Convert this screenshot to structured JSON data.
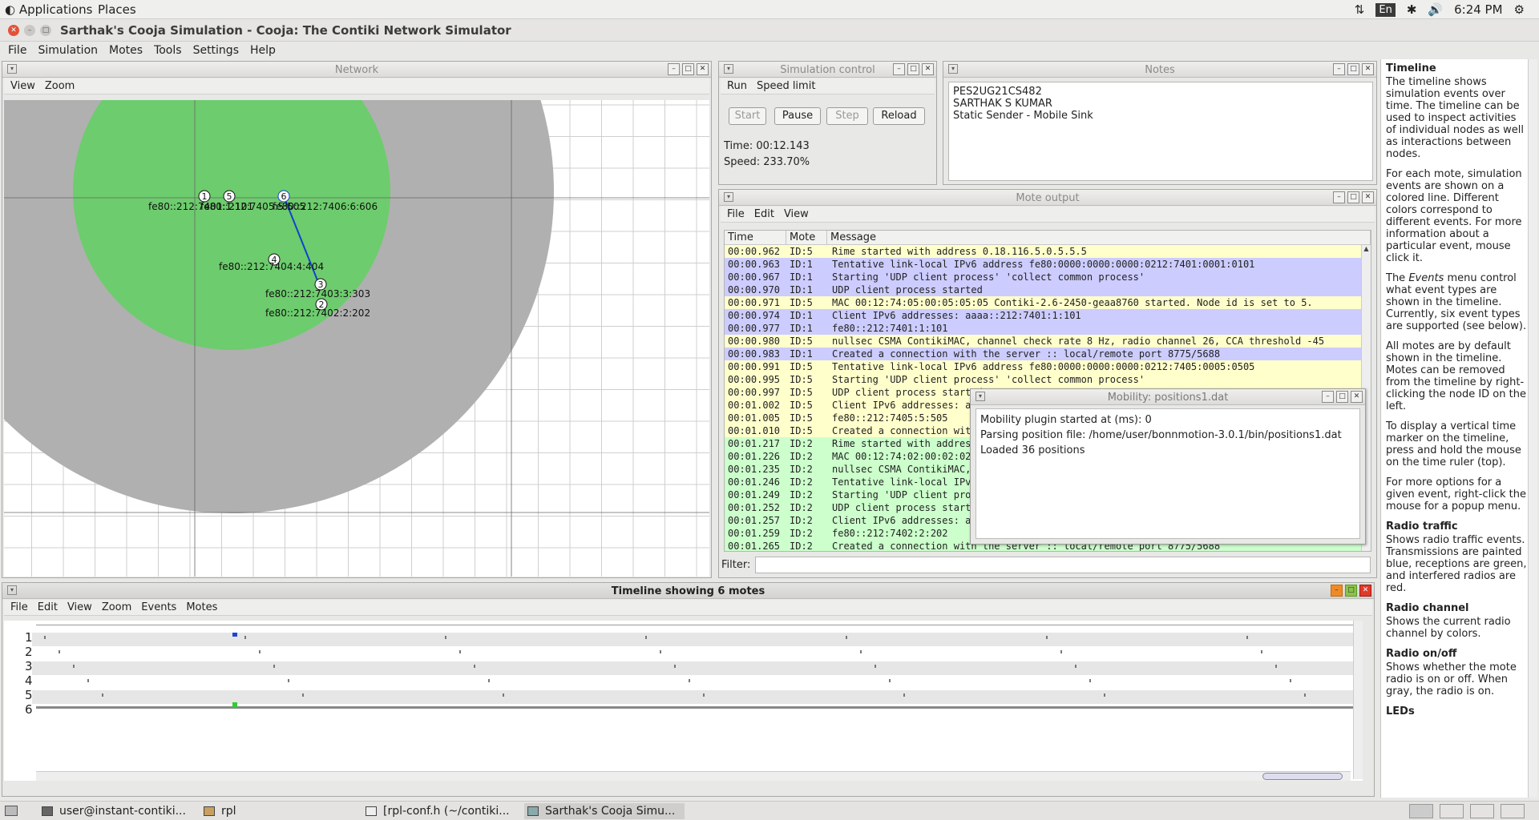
{
  "topbar": {
    "applications": "Applications",
    "places": "Places",
    "lang": "En",
    "time": "6:24 PM"
  },
  "window": {
    "title": "Sarthak's Cooja Simulation - Cooja: The Contiki Network Simulator"
  },
  "menu": [
    "File",
    "Simulation",
    "Motes",
    "Tools",
    "Settings",
    "Help"
  ],
  "network": {
    "title": "Network",
    "menu": [
      "View",
      "Zoom"
    ],
    "nodes": [
      {
        "id": "1",
        "label": "fe80::212:7401:1:101"
      },
      {
        "id": "5",
        "label": "fe80::212:7405:5:505"
      },
      {
        "id": "6",
        "label": "fe80::212:7406:6:606"
      },
      {
        "id": "4",
        "label": "fe80::212:7404:4:404"
      },
      {
        "id": "3",
        "label": "fe80::212:7403:3:303"
      },
      {
        "id": "2",
        "label": "fe80::212:7402:2:202"
      }
    ]
  },
  "simcontrol": {
    "title": "Simulation control",
    "menu": [
      "Run",
      "Speed limit"
    ],
    "start": "Start",
    "pause": "Pause",
    "step": "Step",
    "reload": "Reload",
    "time": "Time: 00:12.143",
    "speed": "Speed: 233.70%"
  },
  "notes": {
    "title": "Notes",
    "lines": [
      "PES2UG21CS482",
      "SARTHAK S KUMAR",
      "Static Sender - Mobile Sink"
    ]
  },
  "moteoutput": {
    "title": "Mote output",
    "menu": [
      "File",
      "Edit",
      "View"
    ],
    "headers": [
      "Time",
      "Mote",
      "Message"
    ],
    "filter_label": "Filter:",
    "rows": [
      [
        "00:00.962",
        "ID:5",
        "Rime started with address 0.18.116.5.0.5.5.5"
      ],
      [
        "00:00.963",
        "ID:1",
        "Tentative link-local IPv6 address fe80:0000:0000:0000:0212:7401:0001:0101"
      ],
      [
        "00:00.967",
        "ID:1",
        "Starting 'UDP client process' 'collect common process'"
      ],
      [
        "00:00.970",
        "ID:1",
        "UDP client process started"
      ],
      [
        "00:00.971",
        "ID:5",
        "MAC 00:12:74:05:00:05:05:05 Contiki-2.6-2450-geaa8760 started. Node id is set to 5."
      ],
      [
        "00:00.974",
        "ID:1",
        "Client IPv6 addresses: aaaa::212:7401:1:101"
      ],
      [
        "00:00.977",
        "ID:1",
        "fe80::212:7401:1:101"
      ],
      [
        "00:00.980",
        "ID:5",
        "nullsec CSMA ContikiMAC, channel check rate 8 Hz, radio channel 26, CCA threshold -45"
      ],
      [
        "00:00.983",
        "ID:1",
        "Created a connection with the server :: local/remote port 8775/5688"
      ],
      [
        "00:00.991",
        "ID:5",
        "Tentative link-local IPv6 address fe80:0000:0000:0000:0212:7405:0005:0505"
      ],
      [
        "00:00.995",
        "ID:5",
        "Starting 'UDP client process' 'collect common process'"
      ],
      [
        "00:00.997",
        "ID:5",
        "UDP client process started"
      ],
      [
        "00:01.002",
        "ID:5",
        "Client IPv6 addresses: aaaa::212:7405:5:505"
      ],
      [
        "00:01.005",
        "ID:5",
        "fe80::212:7405:5:505"
      ],
      [
        "00:01.010",
        "ID:5",
        "Created a connection with the server :: local/remote port 8775/5688"
      ],
      [
        "00:01.217",
        "ID:2",
        "Rime started with address 0.18.116.2.0.2.2.2"
      ],
      [
        "00:01.226",
        "ID:2",
        "MAC 00:12:74:02:00:02:02:02 Contiki-2.6-2450-geaa8760 started. Node id is set to 2."
      ],
      [
        "00:01.235",
        "ID:2",
        "nullsec CSMA ContikiMAC, channel check rate 8 Hz, radio channel 26, CCA threshold -45"
      ],
      [
        "00:01.246",
        "ID:2",
        "Tentative link-local IPv6 address fe80:0000:0000:0000:0212:7402:0002:0202"
      ],
      [
        "00:01.249",
        "ID:2",
        "Starting 'UDP client process' 'collect common process'"
      ],
      [
        "00:01.252",
        "ID:2",
        "UDP client process started"
      ],
      [
        "00:01.257",
        "ID:2",
        "Client IPv6 addresses: aaaa::212:7402:2:202"
      ],
      [
        "00:01.259",
        "ID:2",
        "fe80::212:7402:2:202"
      ],
      [
        "00:01.265",
        "ID:2",
        "Created a connection with the server :: local/remote port 8775/5688"
      ]
    ]
  },
  "mobility": {
    "title": "Mobility: positions1.dat",
    "lines": [
      "Mobility plugin started at (ms): 0",
      "Parsing position file: /home/user/bonnmotion-3.0.1/bin/positions1.dat",
      "Loaded 36 positions"
    ]
  },
  "timeline": {
    "title": "Timeline showing 6 motes",
    "menu": [
      "File",
      "Edit",
      "View",
      "Zoom",
      "Events",
      "Motes"
    ],
    "rows": [
      "1",
      "2",
      "3",
      "4",
      "5",
      "6"
    ]
  },
  "help": {
    "title": "Timeline",
    "p1": "The timeline shows simulation events over time. The timeline can be used to inspect activities of individual nodes as well as interactions between nodes.",
    "p2": "For each mote, simulation events are shown on a colored line. Different colors correspond to different events. For more information about a particular event, mouse click it.",
    "p3_pre": "The ",
    "p3_em": "Events",
    "p3_post": " menu control what event types are shown in the timeline. Currently, six event types are supported (see below).",
    "p4": "All motes are by default shown in the timeline. Motes can be removed from the timeline by right-clicking the node ID on the left.",
    "p5": "To display a vertical time marker on the timeline, press and hold the mouse on the time ruler (top).",
    "p6": "For more options for a given event, right-click the mouse for a popup menu.",
    "h_rt": "Radio traffic",
    "p_rt": "Shows radio traffic events. Transmissions are painted blue, receptions are green, and interfered radios are red.",
    "h_rc": "Radio channel",
    "p_rc": "Shows the current radio channel by colors.",
    "h_ro": "Radio on/off",
    "p_ro": "Shows whether the mote radio is on or off. When gray, the radio is on.",
    "h_led": "LEDs"
  },
  "taskbar": [
    "user@instant-contiki...",
    "rpl",
    "[rpl-conf.h (~/contiki...",
    "Sarthak's Cooja Simu..."
  ],
  "colors": {
    "green_radio": "#6dcc6d",
    "gray_range": "#b0b0b0",
    "yellow_row": "#ffffcc",
    "blue_row": "#ccccff",
    "green_row": "#ccffcc"
  }
}
